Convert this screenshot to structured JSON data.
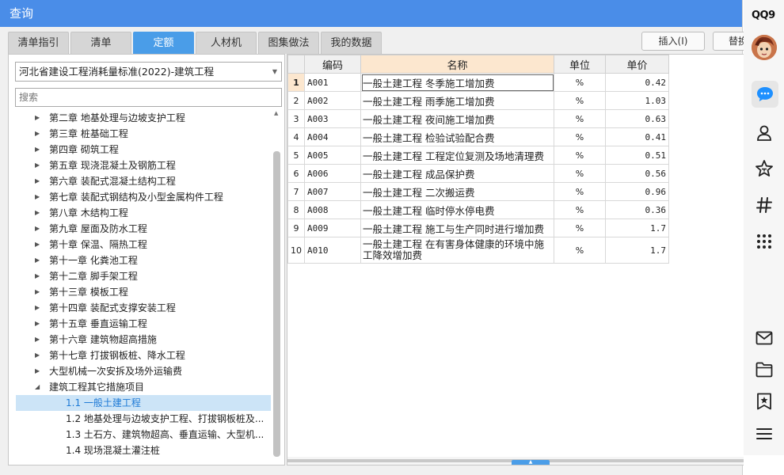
{
  "window": {
    "title": "查询"
  },
  "tabs": [
    {
      "label": "清单指引",
      "active": false
    },
    {
      "label": "清单",
      "active": false
    },
    {
      "label": "定额",
      "active": true
    },
    {
      "label": "人材机",
      "active": false
    },
    {
      "label": "图集做法",
      "active": false
    },
    {
      "label": "我的数据",
      "active": false
    }
  ],
  "toolbar": {
    "insert_label": "插入(I)",
    "replace_label": "替换"
  },
  "standard_select": {
    "value": "河北省建设工程消耗量标准(2022)-建筑工程"
  },
  "search": {
    "placeholder": "搜索"
  },
  "tree": {
    "items": [
      {
        "label": "第二章 地基处理与边坡支护工程"
      },
      {
        "label": "第三章 桩基础工程"
      },
      {
        "label": "第四章 砌筑工程"
      },
      {
        "label": "第五章 现浇混凝土及钢筋工程"
      },
      {
        "label": "第六章 装配式混凝土结构工程"
      },
      {
        "label": "第七章 装配式钢结构及小型金属构件工程"
      },
      {
        "label": "第八章 木结构工程"
      },
      {
        "label": "第九章 屋面及防水工程"
      },
      {
        "label": "第十章 保温、隔热工程"
      },
      {
        "label": "第十一章 化粪池工程"
      },
      {
        "label": "第十二章 脚手架工程"
      },
      {
        "label": "第十三章 模板工程"
      },
      {
        "label": "第十四章 装配式支撑安装工程"
      },
      {
        "label": "第十五章 垂直运输工程"
      },
      {
        "label": "第十六章 建筑物超高措施"
      },
      {
        "label": "第十七章 打拔钢板桩、降水工程"
      },
      {
        "label": "大型机械一次安拆及场外运输费"
      },
      {
        "label": "建筑工程其它措施项目"
      }
    ],
    "children": [
      {
        "label": "1.1 一般土建工程",
        "selected": true
      },
      {
        "label": "1.2 地基处理与边坡支护工程、打拔钢板桩及...",
        "selected": false
      },
      {
        "label": "1.3 土石方、建筑物超高、垂直运输、大型机...",
        "selected": false
      },
      {
        "label": "1.4 现场混凝土灌注桩",
        "selected": false
      }
    ]
  },
  "table": {
    "headers": {
      "code": "编码",
      "name": "名称",
      "unit": "单位",
      "price": "单价"
    },
    "rows": [
      {
        "no": "1",
        "code": "A001",
        "name": "一般土建工程 冬季施工增加费",
        "unit": "%",
        "price": "0.42"
      },
      {
        "no": "2",
        "code": "A002",
        "name": "一般土建工程 雨季施工增加费",
        "unit": "%",
        "price": "1.03"
      },
      {
        "no": "3",
        "code": "A003",
        "name": "一般土建工程 夜间施工增加费",
        "unit": "%",
        "price": "0.63"
      },
      {
        "no": "4",
        "code": "A004",
        "name": "一般土建工程 检验试验配合费",
        "unit": "%",
        "price": "0.41"
      },
      {
        "no": "5",
        "code": "A005",
        "name": "一般土建工程 工程定位复测及场地清理费",
        "unit": "%",
        "price": "0.51"
      },
      {
        "no": "6",
        "code": "A006",
        "name": "一般土建工程 成品保护费",
        "unit": "%",
        "price": "0.56"
      },
      {
        "no": "7",
        "code": "A007",
        "name": "一般土建工程 二次搬运费",
        "unit": "%",
        "price": "0.96"
      },
      {
        "no": "8",
        "code": "A008",
        "name": "一般土建工程 临时停水停电费",
        "unit": "%",
        "price": "0.36"
      },
      {
        "no": "9",
        "code": "A009",
        "name": "一般土建工程 施工与生产同时进行增加费",
        "unit": "%",
        "price": "1.7"
      },
      {
        "no": "10",
        "code": "A010",
        "name": "一般土建工程 在有害身体健康的环境中施工降效增加费",
        "unit": "%",
        "price": "1.7"
      }
    ]
  },
  "qq": {
    "logo": "QQ9",
    "icons": [
      "qq-chat-icon",
      "contacts-icon",
      "favorites-star-icon",
      "channel-hash-icon",
      "apps-grid-icon",
      "mail-icon",
      "folder-icon",
      "bookmark-star-icon",
      "menu-icon"
    ],
    "accent": "#1e90ff"
  }
}
